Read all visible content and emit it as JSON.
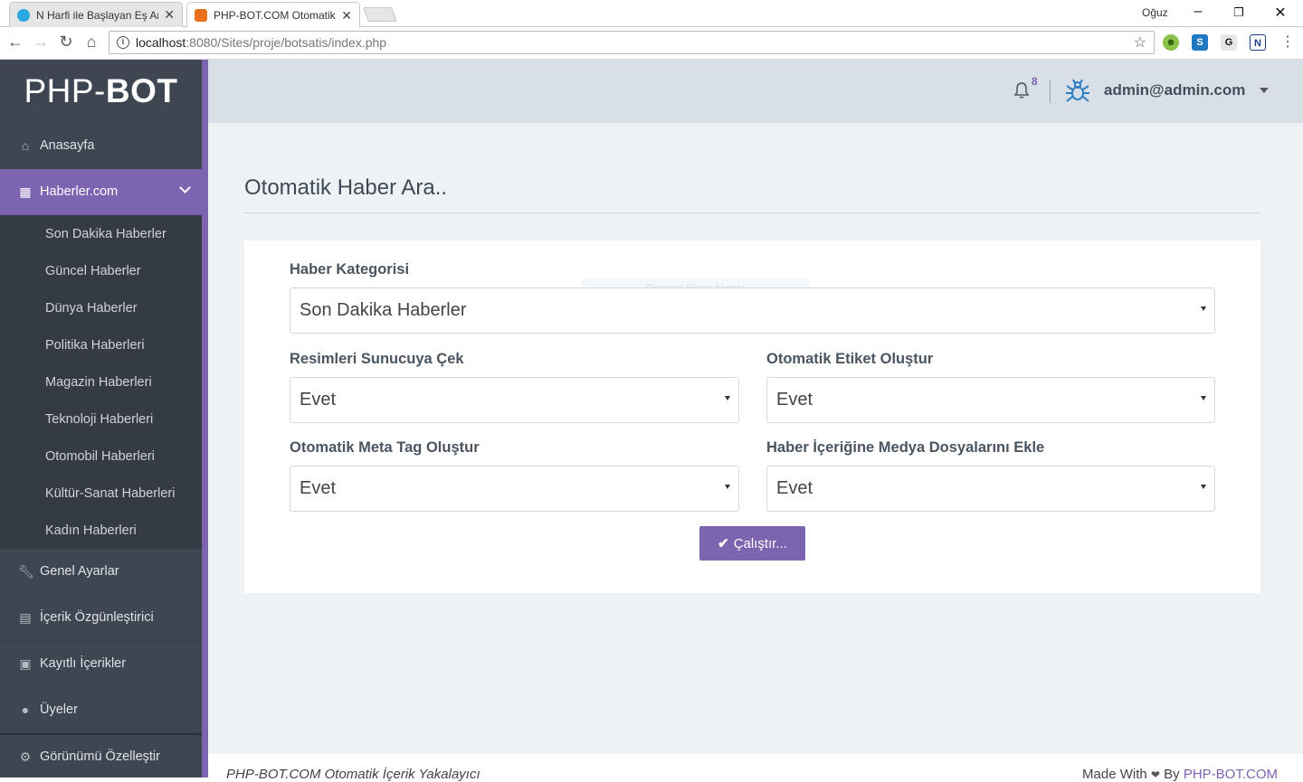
{
  "browser": {
    "tabs": [
      {
        "title": "N Harfi ile Başlayan Eş An",
        "active": false,
        "favicon_color": "#2aa9e0"
      },
      {
        "title": "PHP-BOT.COM Otomatik",
        "active": true,
        "favicon_color": "#e8701c"
      }
    ],
    "profile_name": "Oğuz",
    "url_host": "localhost",
    "url_path": ":8080/Sites/proje/botsatis/index.php",
    "extensions": [
      "frog-extension-icon",
      "s-extension-icon",
      "g-extension-icon",
      "n-extension-icon"
    ]
  },
  "brand": {
    "prefix": "PHP-",
    "bold": "BOT"
  },
  "sidebar": {
    "items": [
      {
        "label": "Anasayfa",
        "icon": "home-icon"
      },
      {
        "label": "Haberler.com",
        "icon": "grid-icon",
        "active": true
      },
      {
        "label": "Genel Ayarlar",
        "icon": "wrench-icon"
      },
      {
        "label": "İçerik Özgünleştirici",
        "icon": "document-icon"
      },
      {
        "label": "Kayıtlı İçerikler",
        "icon": "save-icon"
      },
      {
        "label": "Üyeler",
        "icon": "user-icon"
      },
      {
        "label": "Görünümü Özelleştir",
        "icon": "gear-icon"
      }
    ],
    "submenu": [
      "Son Dakika Haberler",
      "Güncel Haberler",
      "Dünya Haberler",
      "Politika Haberleri",
      "Magazin Haberleri",
      "Teknoloji Haberleri",
      "Otomobil Haberleri",
      "Kültür-Sanat Haberleri",
      "Kadın Haberleri"
    ]
  },
  "topbar": {
    "notification_count": "8",
    "user_email": "admin@admin.com"
  },
  "page": {
    "title": "Otomatik Haber Ara..",
    "ghost_text": "Pencere Ekran Alıntısı",
    "form": {
      "category_label": "Haber Kategorisi",
      "category_value": "Son Dakika Haberler",
      "images_label": "Resimleri Sunucuya Çek",
      "images_value": "Evet",
      "tags_label": "Otomatik Etiket Oluştur",
      "tags_value": "Evet",
      "meta_label": "Otomatik Meta Tag Oluştur",
      "meta_value": "Evet",
      "media_label": "Haber İçeriğine Medya Dosyalarını Ekle",
      "media_value": "Evet",
      "run_label": "Çalıştır..."
    }
  },
  "footer": {
    "left": "PHP-BOT.COM Otomatik İçerik Yakalayıcı",
    "right_prefix": "Made With",
    "right_by": "By",
    "right_link": "PHP-BOT.COM"
  },
  "colors": {
    "accent": "#7d64b1",
    "sidebar": "#3e4651",
    "topbar": "#d8dfe6"
  }
}
